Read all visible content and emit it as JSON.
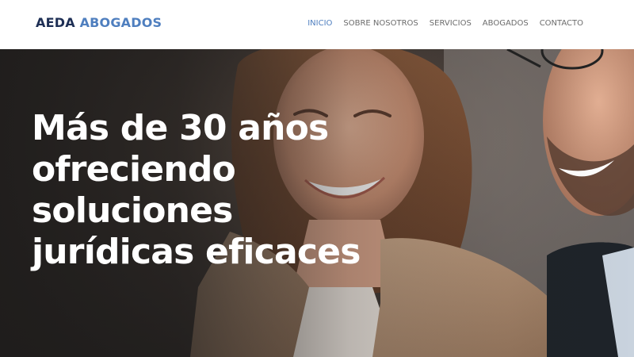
{
  "brand": {
    "part1": "AEDA",
    "part2": "ABOGADOS"
  },
  "nav": {
    "items": [
      {
        "label": "INICIO",
        "active": true
      },
      {
        "label": "SOBRE NOSOTROS",
        "active": false
      },
      {
        "label": "SERVICIOS",
        "active": false
      },
      {
        "label": "ABOGADOS",
        "active": false
      },
      {
        "label": "CONTACTO",
        "active": false
      }
    ]
  },
  "hero": {
    "lines": [
      "Más de 30 años",
      "ofreciendo",
      "soluciones",
      "jurídicas eficaces"
    ]
  },
  "colors": {
    "brand_dark": "#1e2f55",
    "brand_accent": "#4f7fbf",
    "nav_text": "#6c6c6c",
    "hero_text": "#ffffff"
  }
}
